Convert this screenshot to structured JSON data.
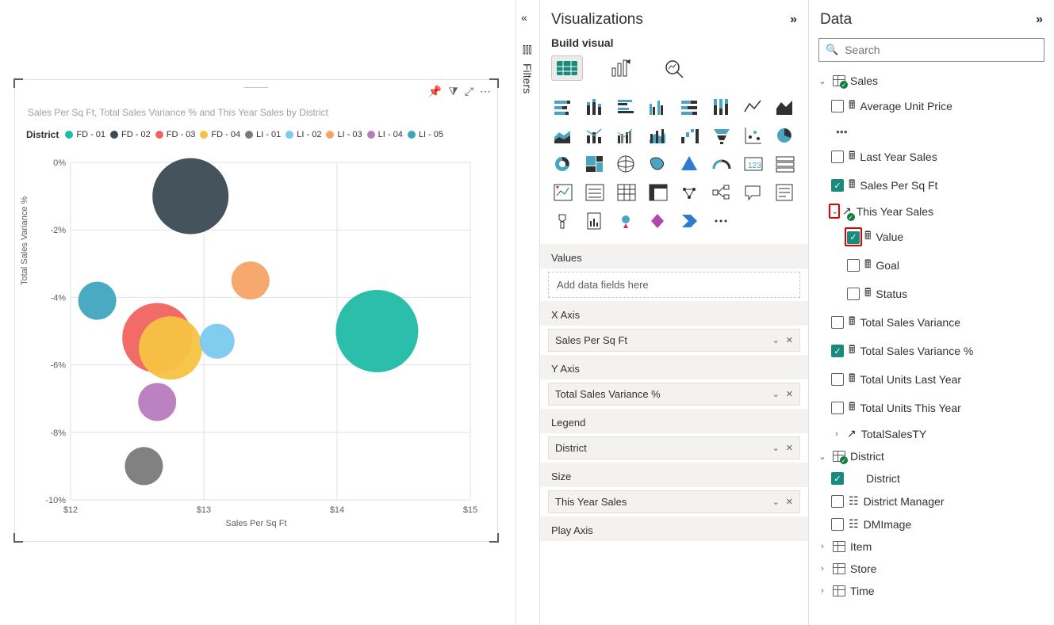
{
  "chart_data": {
    "type": "scatter",
    "title": "Sales Per Sq Ft, Total Sales Variance % and This Year Sales by District",
    "xlabel": "Sales Per Sq Ft",
    "ylabel": "Total Sales Variance %",
    "xlim": [
      12,
      15
    ],
    "ylim": [
      -10,
      0
    ],
    "x_ticks": [
      "$12",
      "$13",
      "$14",
      "$15"
    ],
    "y_ticks": [
      "0%",
      "-2%",
      "-4%",
      "-6%",
      "-8%",
      "-10%"
    ],
    "legend_title": "District",
    "series": [
      {
        "name": "FD - 01",
        "color": "#1fbba6",
        "x": 14.3,
        "y": -5.0,
        "size": 52
      },
      {
        "name": "FD - 02",
        "color": "#3b4a54",
        "x": 12.9,
        "y": -1.0,
        "size": 48
      },
      {
        "name": "FD - 03",
        "color": "#f1635e",
        "x": 12.65,
        "y": -5.2,
        "size": 44
      },
      {
        "name": "FD - 04",
        "color": "#f5c342",
        "x": 12.75,
        "y": -5.5,
        "size": 40
      },
      {
        "name": "LI - 01",
        "color": "#7a7a7a",
        "x": 12.55,
        "y": -9.0,
        "size": 24
      },
      {
        "name": "LI - 02",
        "color": "#7ac9ee",
        "x": 13.1,
        "y": -5.3,
        "size": 22
      },
      {
        "name": "LI - 03",
        "color": "#f7a367",
        "x": 13.35,
        "y": -3.5,
        "size": 24
      },
      {
        "name": "LI - 04",
        "color": "#b77bbf",
        "x": 12.65,
        "y": -7.1,
        "size": 24
      },
      {
        "name": "LI - 05",
        "color": "#3fa5bf",
        "x": 12.2,
        "y": -4.1,
        "size": 24
      }
    ]
  },
  "filters_tab": {
    "label": "Filters"
  },
  "viz_pane": {
    "title": "Visualizations",
    "subtitle": "Build visual",
    "wells": {
      "values_label": "Values",
      "values_placeholder": "Add data fields here",
      "x_label": "X Axis",
      "x_value": "Sales Per Sq Ft",
      "y_label": "Y Axis",
      "y_value": "Total Sales Variance %",
      "legend_label": "Legend",
      "legend_value": "District",
      "size_label": "Size",
      "size_value": "This Year Sales",
      "play_label": "Play Axis"
    }
  },
  "data_pane": {
    "title": "Data",
    "search_placeholder": "Search",
    "tree": {
      "sales": {
        "label": "Sales",
        "fields": {
          "avg_unit_price": "Average Unit Price",
          "last_year_sales": "Last Year Sales",
          "sales_per_sqft": "Sales Per Sq Ft",
          "this_year_sales": "This Year Sales",
          "tys_value": "Value",
          "tys_goal": "Goal",
          "tys_status": "Status",
          "total_sales_variance": "Total Sales Variance",
          "total_sales_variance_pct": "Total Sales Variance %",
          "total_units_last_year": "Total Units Last Year",
          "total_units_this_year": "Total Units This Year",
          "total_sales_ty": "TotalSalesTY"
        }
      },
      "district": {
        "label": "District",
        "fields": {
          "district": "District",
          "district_manager": "District Manager",
          "dm_image": "DMImage"
        }
      },
      "item": {
        "label": "Item"
      },
      "store": {
        "label": "Store"
      },
      "time": {
        "label": "Time"
      }
    }
  }
}
